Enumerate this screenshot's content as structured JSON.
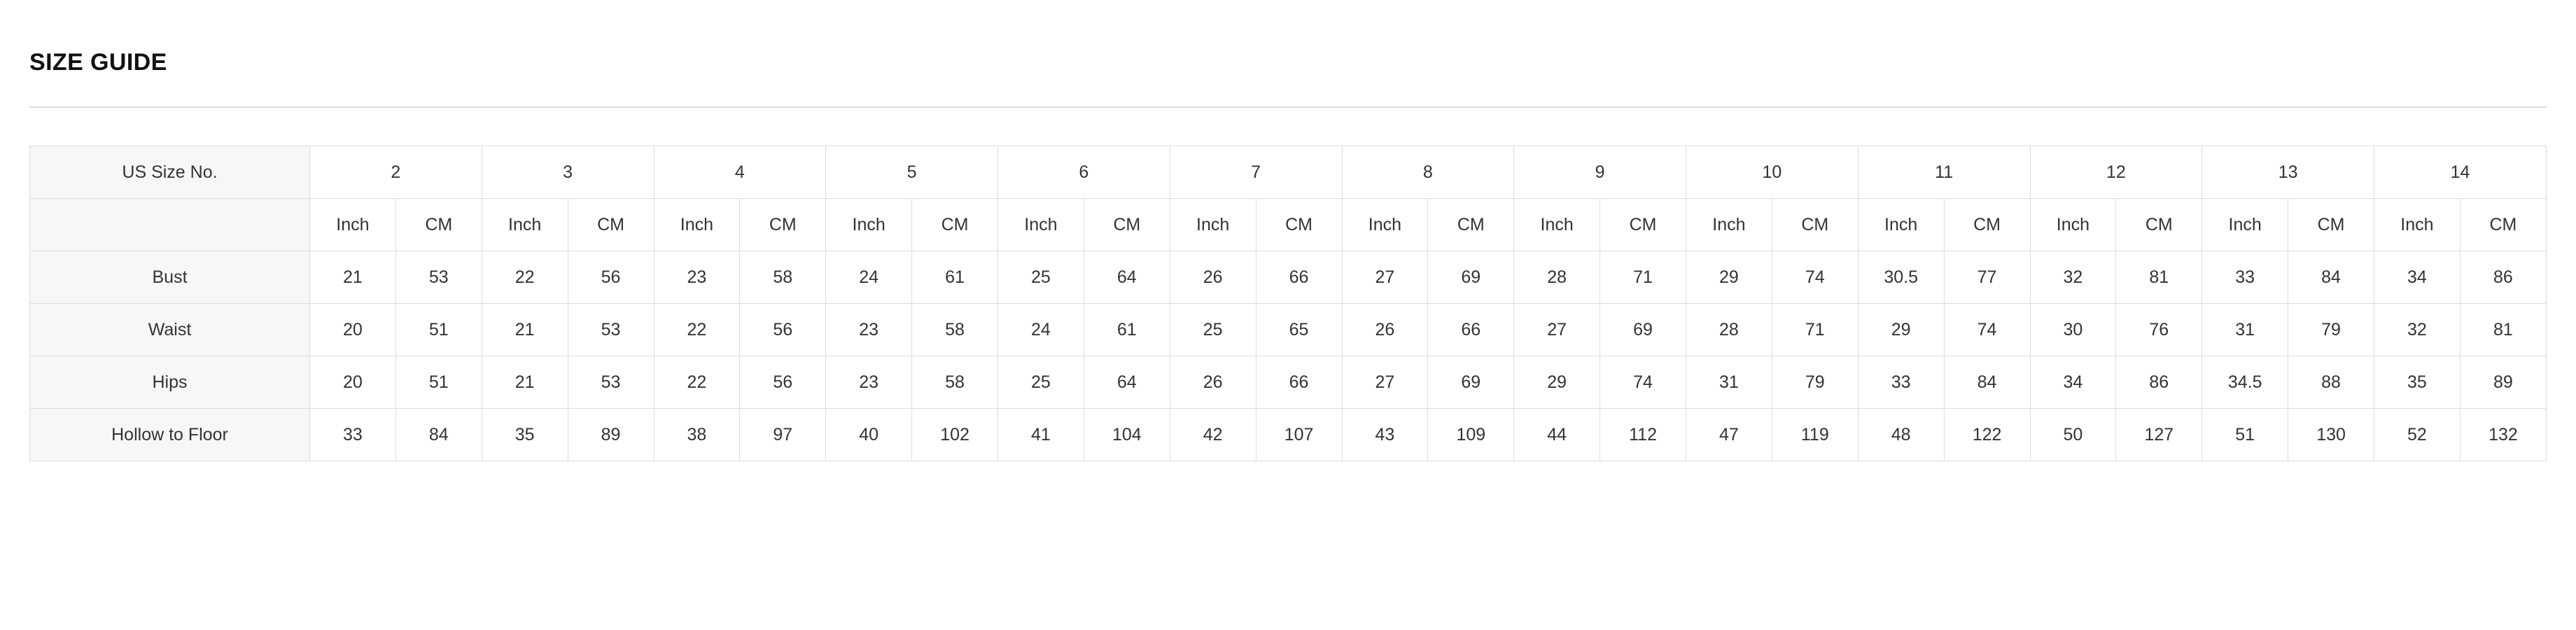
{
  "header": {
    "title": "SIZE GUIDE"
  },
  "table": {
    "size_label": "US Size No.",
    "unit_blank_label": "",
    "units": [
      "Inch",
      "CM"
    ],
    "sizes": [
      "2",
      "3",
      "4",
      "5",
      "6",
      "7",
      "8",
      "9",
      "10",
      "11",
      "12",
      "13",
      "14"
    ],
    "rows": [
      {
        "label": "Bust",
        "values": [
          "21",
          "53",
          "22",
          "56",
          "23",
          "58",
          "24",
          "61",
          "25",
          "64",
          "26",
          "66",
          "27",
          "69",
          "28",
          "71",
          "29",
          "74",
          "30.5",
          "77",
          "32",
          "81",
          "33",
          "84",
          "34",
          "86"
        ]
      },
      {
        "label": "Waist",
        "values": [
          "20",
          "51",
          "21",
          "53",
          "22",
          "56",
          "23",
          "58",
          "24",
          "61",
          "25",
          "65",
          "26",
          "66",
          "27",
          "69",
          "28",
          "71",
          "29",
          "74",
          "30",
          "76",
          "31",
          "79",
          "32",
          "81"
        ]
      },
      {
        "label": "Hips",
        "values": [
          "20",
          "51",
          "21",
          "53",
          "22",
          "56",
          "23",
          "58",
          "25",
          "64",
          "26",
          "66",
          "27",
          "69",
          "29",
          "74",
          "31",
          "79",
          "33",
          "84",
          "34",
          "86",
          "34.5",
          "88",
          "35",
          "89"
        ]
      },
      {
        "label": "Hollow to Floor",
        "values": [
          "33",
          "84",
          "35",
          "89",
          "38",
          "97",
          "40",
          "102",
          "41",
          "104",
          "42",
          "107",
          "43",
          "109",
          "44",
          "112",
          "47",
          "119",
          "48",
          "122",
          "50",
          "127",
          "51",
          "130",
          "52",
          "132"
        ]
      }
    ]
  },
  "colors": {
    "border": "#dddddd",
    "label_background": "#f7f7f7",
    "text": "#333333",
    "title": "#111111"
  }
}
